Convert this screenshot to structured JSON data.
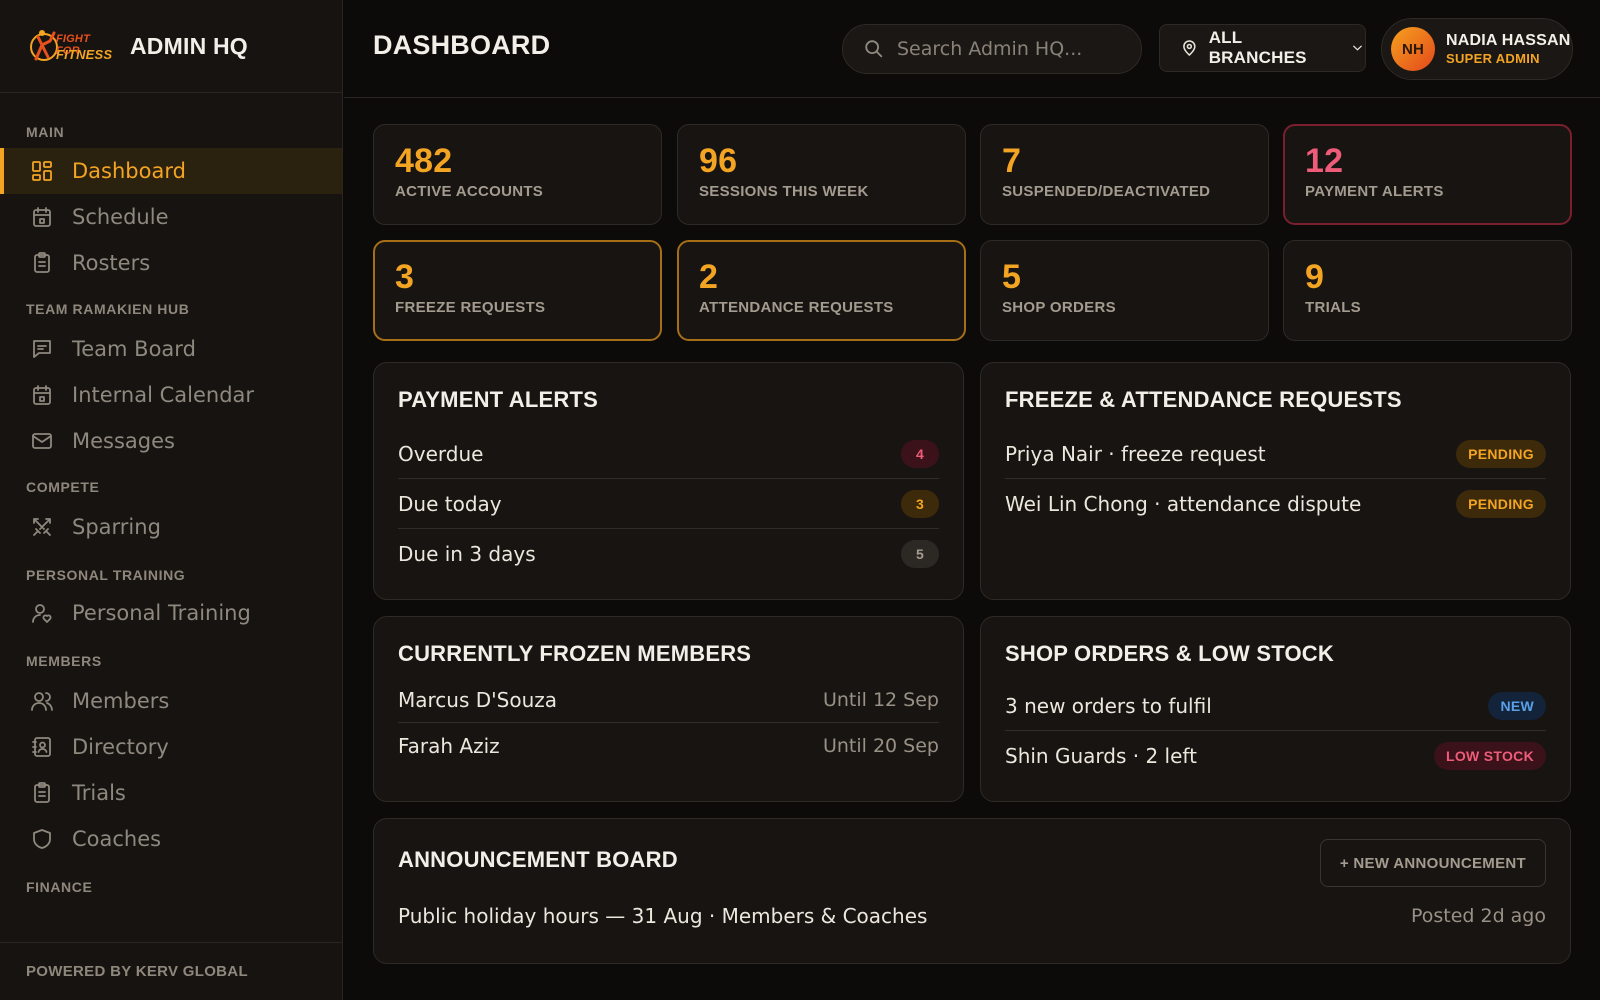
{
  "app": {
    "brand_title": "ADMIN HQ",
    "logo_line1": "FIGHT FOR",
    "logo_line2": "FITNESS",
    "footer": "POWERED BY KERV GLOBAL"
  },
  "sidebar": {
    "sections": [
      {
        "label": "MAIN",
        "items": [
          {
            "label": "Dashboard",
            "icon": "dashboard-icon",
            "active": true
          },
          {
            "label": "Schedule",
            "icon": "calendar-icon"
          },
          {
            "label": "Rosters",
            "icon": "clipboard-icon"
          }
        ]
      },
      {
        "label": "TEAM RAMAKIEN HUB",
        "items": [
          {
            "label": "Team Board",
            "icon": "message-square-icon"
          },
          {
            "label": "Internal Calendar",
            "icon": "calendar-icon"
          },
          {
            "label": "Messages",
            "icon": "mail-icon"
          }
        ]
      },
      {
        "label": "COMPETE",
        "items": [
          {
            "label": "Sparring",
            "icon": "swords-icon"
          }
        ]
      },
      {
        "label": "PERSONAL TRAINING",
        "items": [
          {
            "label": "Personal Training",
            "icon": "user-heart-icon"
          }
        ]
      },
      {
        "label": "MEMBERS",
        "items": [
          {
            "label": "Members",
            "icon": "users-icon"
          },
          {
            "label": "Directory",
            "icon": "contact-book-icon"
          },
          {
            "label": "Trials",
            "icon": "clipboard-icon"
          },
          {
            "label": "Coaches",
            "icon": "shield-icon"
          }
        ]
      },
      {
        "label": "FINANCE",
        "items": []
      }
    ]
  },
  "header": {
    "title": "DASHBOARD",
    "search_placeholder": "Search Admin HQ...",
    "branch": "ALL BRANCHES",
    "user": {
      "initials": "NH",
      "name": "NADIA HASSAN",
      "role": "SUPER ADMIN"
    }
  },
  "stats": [
    {
      "value": "482",
      "label": "ACTIVE ACCOUNTS"
    },
    {
      "value": "96",
      "label": "SESSIONS THIS WEEK"
    },
    {
      "value": "7",
      "label": "SUSPENDED/DEACTIVATED"
    },
    {
      "value": "12",
      "label": "PAYMENT ALERTS"
    },
    {
      "value": "3",
      "label": "FREEZE REQUESTS"
    },
    {
      "value": "2",
      "label": "ATTENDANCE REQUESTS"
    },
    {
      "value": "5",
      "label": "SHOP ORDERS"
    },
    {
      "value": "9",
      "label": "TRIALS"
    }
  ],
  "payment_alerts": {
    "title": "PAYMENT ALERTS",
    "rows": [
      {
        "label": "Overdue",
        "count": "4"
      },
      {
        "label": "Due today",
        "count": "3"
      },
      {
        "label": "Due in 3 days",
        "count": "5"
      }
    ]
  },
  "requests": {
    "title": "FREEZE & ATTENDANCE REQUESTS",
    "rows": [
      {
        "label": "Priya Nair · freeze request",
        "status": "PENDING"
      },
      {
        "label": "Wei Lin Chong · attendance dispute",
        "status": "PENDING"
      }
    ]
  },
  "frozen": {
    "title": "CURRENTLY FROZEN MEMBERS",
    "rows": [
      {
        "name": "Marcus D'Souza",
        "until": "Until 12 Sep"
      },
      {
        "name": "Farah Aziz",
        "until": "Until 20 Sep"
      }
    ]
  },
  "shop": {
    "title": "SHOP ORDERS & LOW STOCK",
    "rows": [
      {
        "label": "3 new orders to fulfil",
        "tag": "NEW"
      },
      {
        "label": "Shin Guards · 2 left",
        "tag": "LOW STOCK"
      }
    ]
  },
  "announcements": {
    "title": "ANNOUNCEMENT BOARD",
    "button": "+ NEW ANNOUNCEMENT",
    "item": {
      "text": "Public holiday hours — 31 Aug · Members & Coaches",
      "posted": "Posted 2d ago"
    }
  },
  "colors": {
    "accent": "#f3a422",
    "alert": "#ef5c7a",
    "bg": "#0c0b0a",
    "panel": "#171412"
  }
}
